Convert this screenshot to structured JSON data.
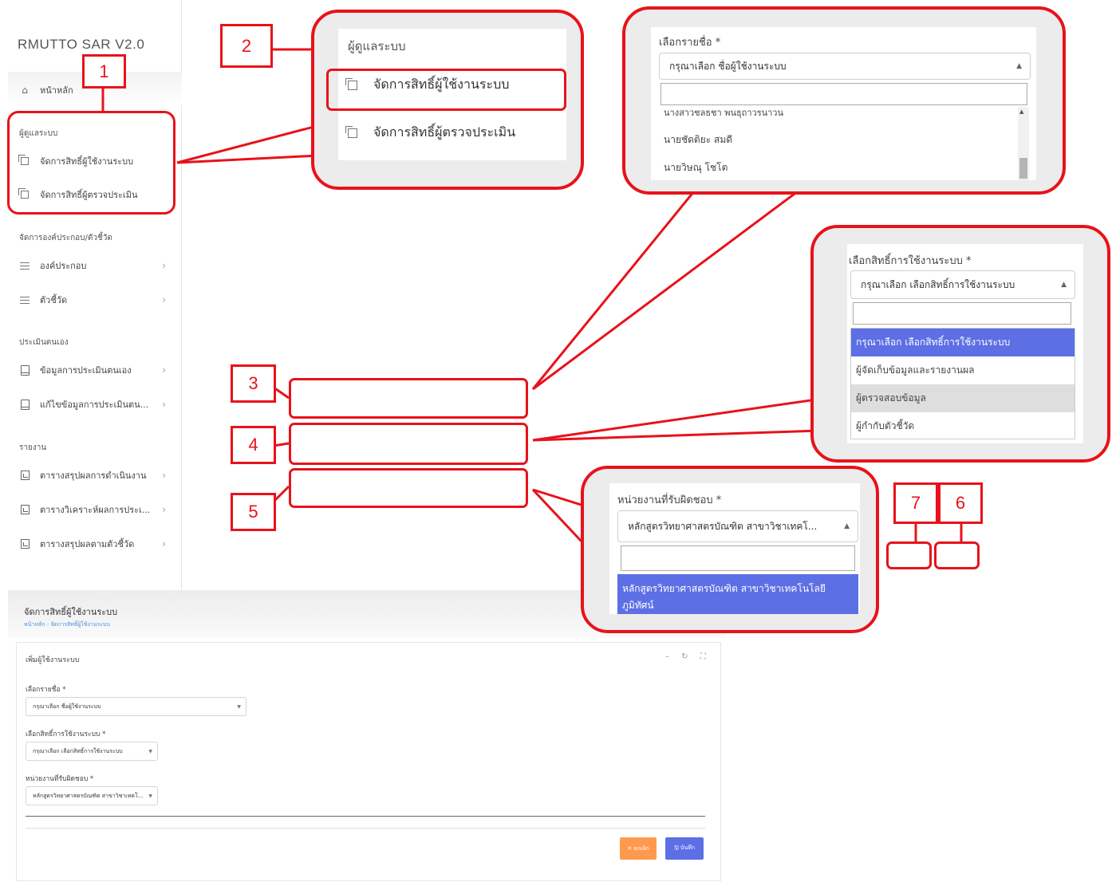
{
  "app": {
    "brand": "RMUTTO SAR V2.0"
  },
  "sidebar": {
    "home": "หน้าหลัก",
    "admin_section": "ผู้ดูแลระบบ",
    "admin_items": [
      "จัดการสิทธิ์ผู้ใช้งานระบบ",
      "จัดการสิทธิ์ผู้ตรวจประเมิน"
    ],
    "component_section": "จัดการองค์ประกอบ/ตัวชี้วัด",
    "component_items": [
      "องค์ประกอบ",
      "ตัวชี้วัด"
    ],
    "self_section": "ประเมินตนเอง",
    "self_items": [
      "ข้อมูลการประเมินตนเอง",
      "แก้ไขข้อมูลการประเมินตน..."
    ],
    "report_section": "รายงาน",
    "report_items": [
      "ตารางสรุปผลการดำเนินงาน",
      "ตารางวิเคราะห์ผลการประเ...",
      "ตารางสรุปผลตามตัวชี้วัด"
    ]
  },
  "annotations": {
    "n1": "1",
    "n2": "2",
    "n3": "3",
    "n4": "4",
    "n5": "5",
    "n6": "6",
    "n7": "7"
  },
  "callout2": {
    "header": "ผู้ดูแลระบบ",
    "items": [
      "จัดการสิทธิ์ผู้ใช้งานระบบ",
      "จัดการสิทธิ์ผู้ตรวจประเมิน"
    ]
  },
  "callout3": {
    "label": "เลือกรายชื่อ *",
    "placeholder": "กรุณาเลือก ชื่อผู้ใช้งานระบบ",
    "options": [
      "นางสาวชลธชา พนธุถาวรนาวน",
      "นายชัดติยะ สมดี",
      "นายวิษณุ โชโต"
    ]
  },
  "callout4": {
    "label": "เลือกสิทธิ์การใช้งานระบบ *",
    "placeholder": "กรุณาเลือก เลือกสิทธิ์การใช้งานระบบ",
    "options": [
      "กรุณาเลือก เลือกสิทธิ์การใช้งานระบบ",
      "ผู้จัดเก็บข้อมูลและรายงานผล",
      "ผู้ตรวจสอบข้อมูล",
      "ผู้กำกับตัวชี้วัด"
    ]
  },
  "callout5": {
    "label": "หน่วยงานที่รับผิดชอบ *",
    "value": "หลักสูตรวิทยาศาสตรบัณฑิต สาขาวิชาเทคโ...",
    "option_line1": "หลักสูตรวิทยาศาสตรบัณฑิต สาขาวิชาเทคโนโลยี",
    "option_line2": "ภูมิทัศน์"
  },
  "page": {
    "title": "จัดการสิทธิ์ผู้ใช้งานระบบ",
    "breadcrumb": "หน้าหลัก - จัดการสิทธิ์ผู้ใช้งานระบบ",
    "card_title": "เพิ่มผู้ใช้งานระบบ",
    "tools": "– ↻ ⛶",
    "field1_label": "เลือกรายชื่อ *",
    "field1_value": "กรุณาเลือก ชื่อผู้ใช้งานระบบ",
    "field2_label": "เลือกสิทธิ์การใช้งานระบบ *",
    "field2_value": "กรุณาเลือก เลือกสิทธิ์การใช้งานระบบ",
    "field3_label": "หน่วยงานที่รับผิดชอบ *",
    "field3_value": "หลักสูตรวิทยาศาสตรบัณฑิต สาขาวิชาเทคโ...",
    "cancel_label": "✕ ยกเลิก",
    "save_label": "🖫 บันทึก"
  },
  "colors": {
    "annotation": "#e8121a",
    "highlight": "#5d6fe4",
    "cancel": "#ff9a4d"
  }
}
